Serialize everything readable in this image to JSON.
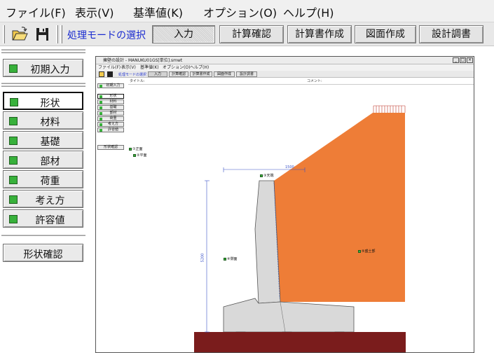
{
  "menubar": {
    "items": [
      "ファイル(F)",
      "表示(V)",
      "基準値(K)",
      "オプション(O)",
      "ヘルプ(H)"
    ]
  },
  "toolbar": {
    "open_icon": "folder-open-icon",
    "save_icon": "floppy-disk-icon",
    "mode_label": "処理モードの選択",
    "buttons": [
      "入力",
      "計算確認",
      "計算書作成",
      "図面作成",
      "設計調書"
    ],
    "active_button": "入力"
  },
  "left_panel": {
    "initial_input": "初期入力",
    "items": [
      "形状",
      "材料",
      "基礎",
      "部材",
      "荷重",
      "考え方",
      "許容値"
    ],
    "selected": "形状",
    "confirm_button": "形状確認"
  },
  "inner_window": {
    "title": "擁壁の設計 - MANUKU01GS[単位].smwt",
    "menu": [
      "ファイル(F)",
      "表示(V)",
      "基準値(K)",
      "オプション(O)",
      "ヘルプ(H)"
    ],
    "mode_label": "処理モードの選択",
    "buttons": [
      "入力",
      "計算確認",
      "計算書作成",
      "図面作成",
      "設計調書"
    ],
    "title_field": "タイトル:",
    "comment_field": "コメント:",
    "side_initial": "初期入力",
    "side_items": [
      "形状",
      "材料",
      "基礎",
      "部材",
      "荷重",
      "考え方",
      "許容値"
    ],
    "side_confirm": "形状確認",
    "drawing_labels": {
      "front": "①正面",
      "plan": "②平面",
      "crest": "③天端",
      "side": "④側面",
      "backfill": "⑤盛土部",
      "width_dim": "1500",
      "height_dim": "5200"
    },
    "colors": {
      "backfill": "#ee7d37",
      "concrete": "#d9d9d9",
      "foundation": "#7a1c1c",
      "pile": "#8c8c8c"
    }
  }
}
